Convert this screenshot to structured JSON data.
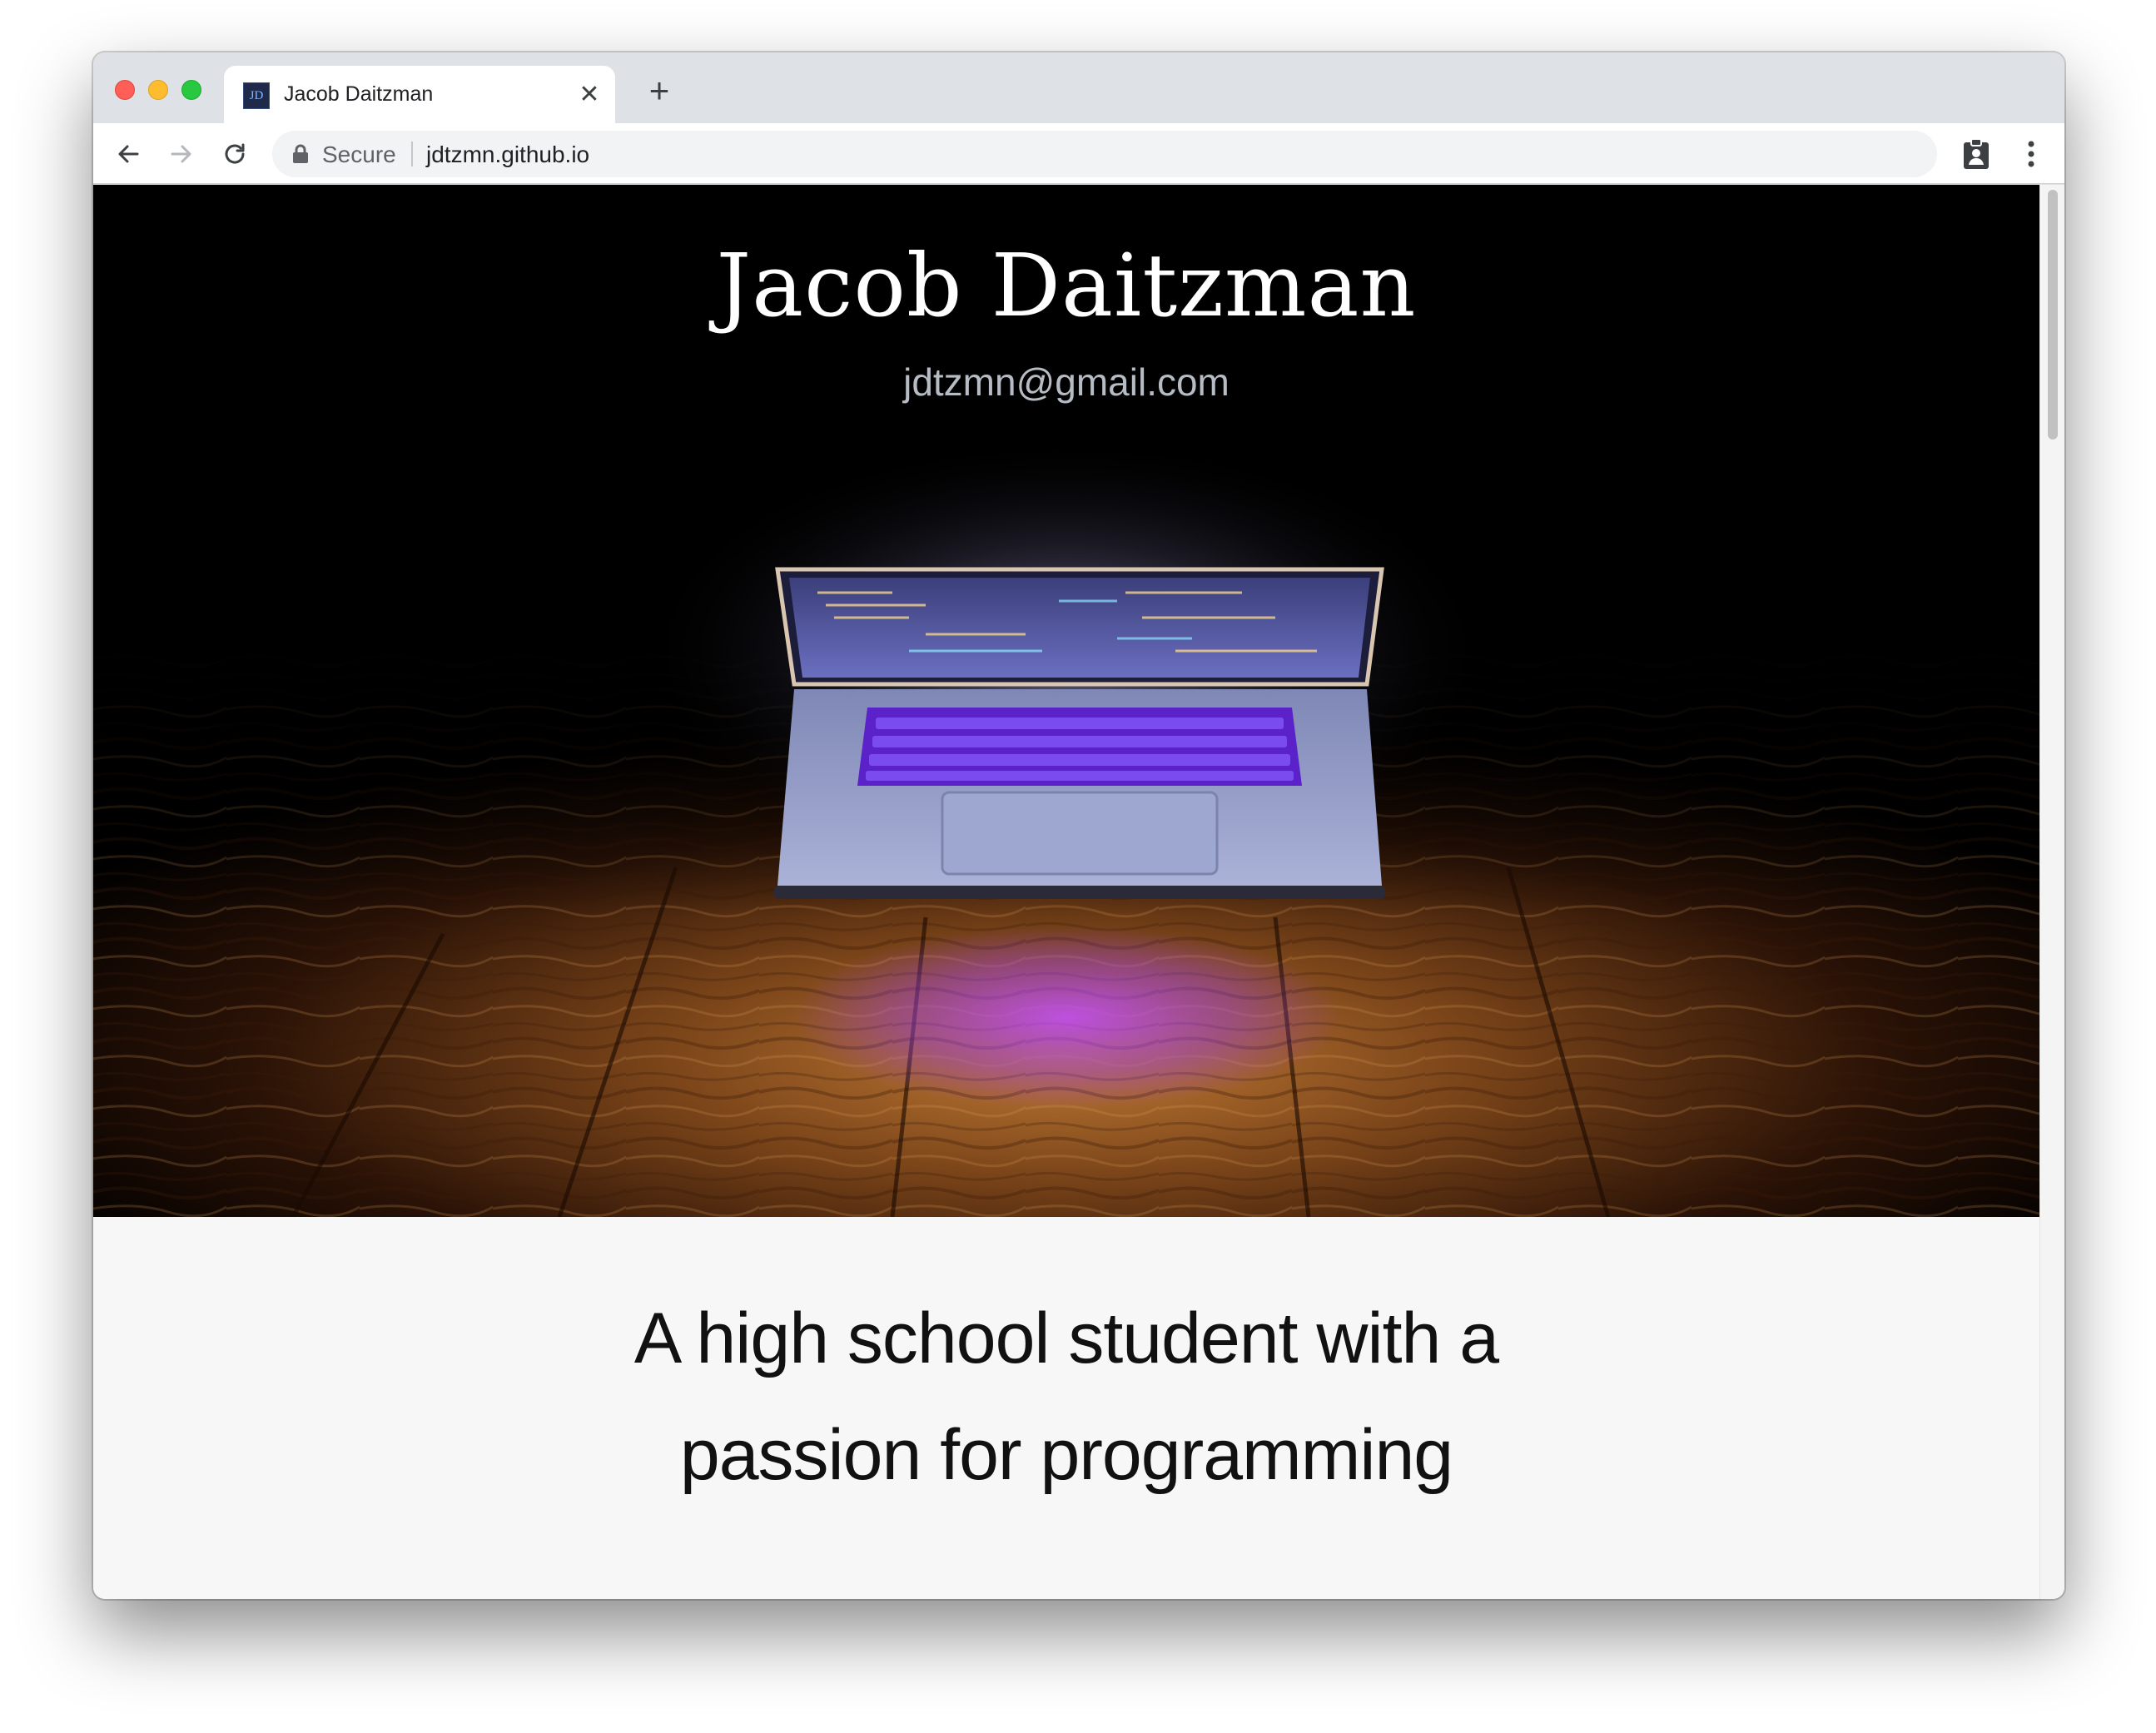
{
  "browser": {
    "tab": {
      "favicon_text": "JD",
      "title": "Jacob Daitzman",
      "close_glyph": "✕"
    },
    "new_tab_glyph": "+",
    "address_bar": {
      "security_label": "Secure",
      "url": "jdtzmn.github.io"
    },
    "icons": [
      "back-arrow-icon",
      "forward-arrow-icon",
      "reload-icon",
      "lock-icon",
      "extension-icon",
      "kebab-menu-icon"
    ]
  },
  "page": {
    "hero": {
      "title": "Jacob Daitzman",
      "email": "jdtzmn@gmail.com"
    },
    "tagline": {
      "line1": "A high school student with a",
      "line2": "passion for programming"
    }
  },
  "colors": {
    "hero_background": "#000000",
    "page_background": "#f7f7f7",
    "laptop_glow": "#9b4dff",
    "wood": "#9c5a22"
  }
}
